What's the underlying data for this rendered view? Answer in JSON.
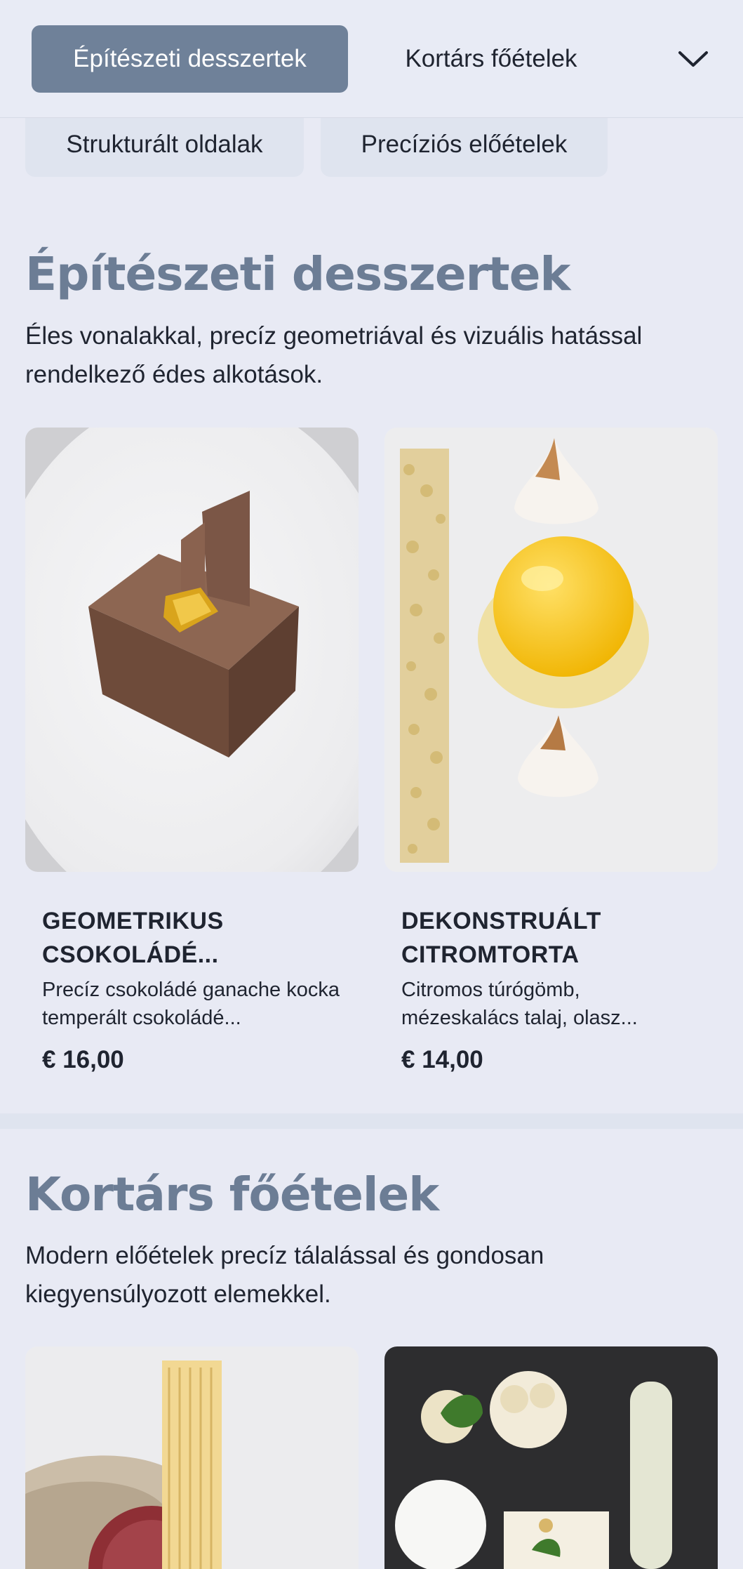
{
  "nav": {
    "active_tab": "Építészeti desszertek",
    "tab2": "Kortárs főételek",
    "chips": [
      "Strukturált oldalak",
      "Precíziós előételek"
    ]
  },
  "sections": [
    {
      "title": "Építészeti desszertek",
      "description": "Éles vonalakkal, precíz geometriával és vizuális hatással rendelkező édes alkotások.",
      "items": [
        {
          "name": "GEOMETRIKUS CSOKOLÁDÉ...",
          "description": "Precíz csokoládé ganache kocka temperált csokoládé...",
          "price": "€ 16,00"
        },
        {
          "name": "DEKONSTRUÁLT CITROMTORTA",
          "description": "Citromos túrógömb, mézeskalács talaj, olasz...",
          "price": "€ 14,00"
        }
      ]
    },
    {
      "title": "Kortárs főételek",
      "description": "Modern előételek precíz tálalással és gondosan kiegyensúlyozott elemekkel."
    }
  ],
  "colors": {
    "background": "#e8eaf4",
    "accent": "#6f8199",
    "heading": "#6c7d95",
    "text": "#1f2430"
  }
}
